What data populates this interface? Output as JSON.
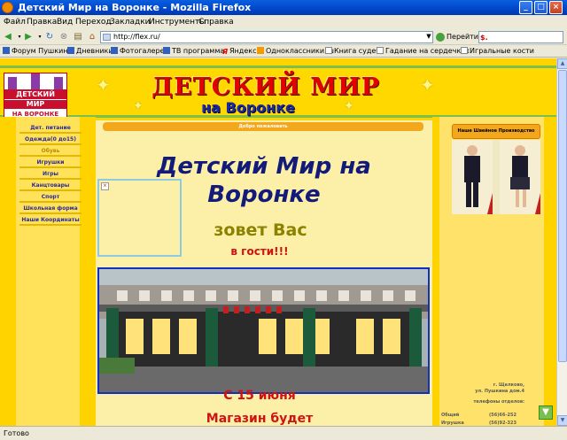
{
  "window": {
    "title": "Детский Мир на Воронке - Mozilla Firefox",
    "controls": {
      "minimize": "_",
      "maximize": "□",
      "close": "×"
    }
  },
  "menu": [
    "Файл",
    "Правка",
    "Вид",
    "Переход",
    "Закладки",
    "Инструменты",
    "Справка"
  ],
  "nav": {
    "url": "http://flex.ru/",
    "go_label": "Перейти",
    "search_value": ""
  },
  "bookmarks": [
    "Форум Пушкино",
    "Дневники",
    "Фотогалерея",
    "ТВ программа",
    "Яндекс",
    "Одноклассники.ru",
    "Книга судеб",
    "Гадание на сердечках",
    "Игральные кости"
  ],
  "banner": {
    "logo_line1": "ДЕТСКИЙ",
    "logo_line2": "МИР",
    "logo_line3": "НА ВОРОНКЕ",
    "title": "ДЕТСКИЙ МИР",
    "subtitle": "на Воронке"
  },
  "left_menu": [
    {
      "label": "Дет. питание",
      "dim": false
    },
    {
      "label": "Одежда(0 до15)",
      "dim": false
    },
    {
      "label": "Обувь",
      "dim": true
    },
    {
      "label": "Игрушки",
      "dim": false
    },
    {
      "label": "Игры",
      "dim": false
    },
    {
      "label": "Канцтовары",
      "dim": false
    },
    {
      "label": "Спорт",
      "dim": false
    },
    {
      "label": "Школьная форма",
      "dim": false
    },
    {
      "label": "Наши Координаты",
      "dim": false
    }
  ],
  "center": {
    "welcome": "Добро пожаловать",
    "headline_line1": "Детский Мир на",
    "headline_line2": "Воронке",
    "zovet": "зовет Вас",
    "v_gosti": "в гости!!!",
    "date": "С 15 июня",
    "magazin": "Магазин будет"
  },
  "right": {
    "sewing_button": "Наше Швейное Производство",
    "address_city": "г. Щелково,",
    "address_street": "ул. Пушкина дом.4",
    "phones_title": "телефоны отделов:",
    "phones": [
      {
        "name": "Общий",
        "value": "(56)66-252"
      },
      {
        "name": "Игрушка",
        "value": "(56)92-323"
      }
    ]
  },
  "status": "Готово",
  "colors": {
    "page_bg": "#ffd300",
    "center_bg": "#fcf0a8",
    "headline": "#131b7a",
    "accent_red": "#d11212",
    "welcome_bar": "#f2a71c"
  }
}
